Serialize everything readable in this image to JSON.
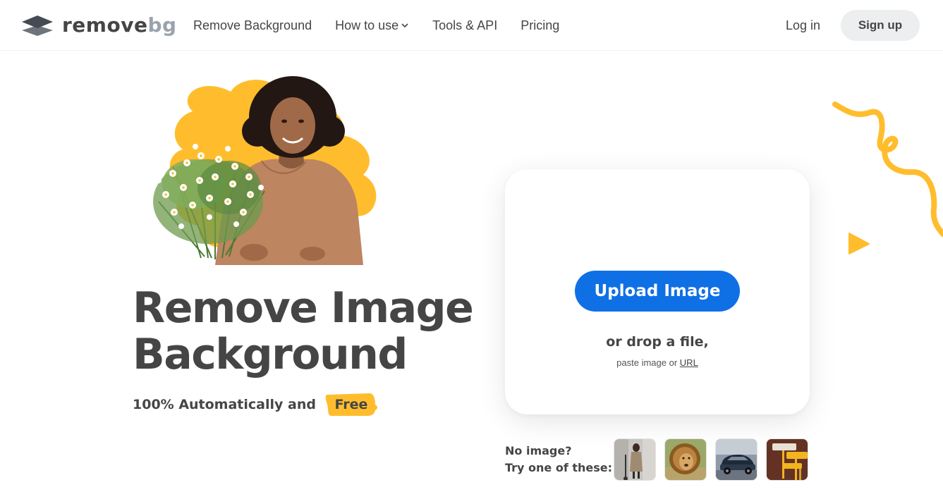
{
  "header": {
    "logo": {
      "text_main": "remove",
      "text_accent": "bg",
      "icon": "layers-logo-icon"
    },
    "nav": [
      {
        "label": "Remove Background"
      },
      {
        "label": "How to use",
        "icon": "chevron-down-icon"
      },
      {
        "label": "Tools & API"
      },
      {
        "label": "Pricing"
      }
    ],
    "login_label": "Log in",
    "signup_label": "Sign up"
  },
  "hero": {
    "title_line1": "Remove Image",
    "title_line2": "Background",
    "subtitle": "100% Automatically and",
    "badge": "Free"
  },
  "upload": {
    "button_label": "Upload Image",
    "drop_text": "or drop a file,",
    "paste_text": "paste image or",
    "url_label": "URL"
  },
  "samples": {
    "label_line1": "No image?",
    "label_line2": "Try one of these:",
    "items": [
      "sample-person-scooter",
      "sample-lion",
      "sample-car",
      "sample-paint-rollers"
    ]
  },
  "colors": {
    "accent": "#0f70e6",
    "yellow": "#ffbd2e",
    "text": "#454545",
    "signup_bg": "#eceef0"
  }
}
